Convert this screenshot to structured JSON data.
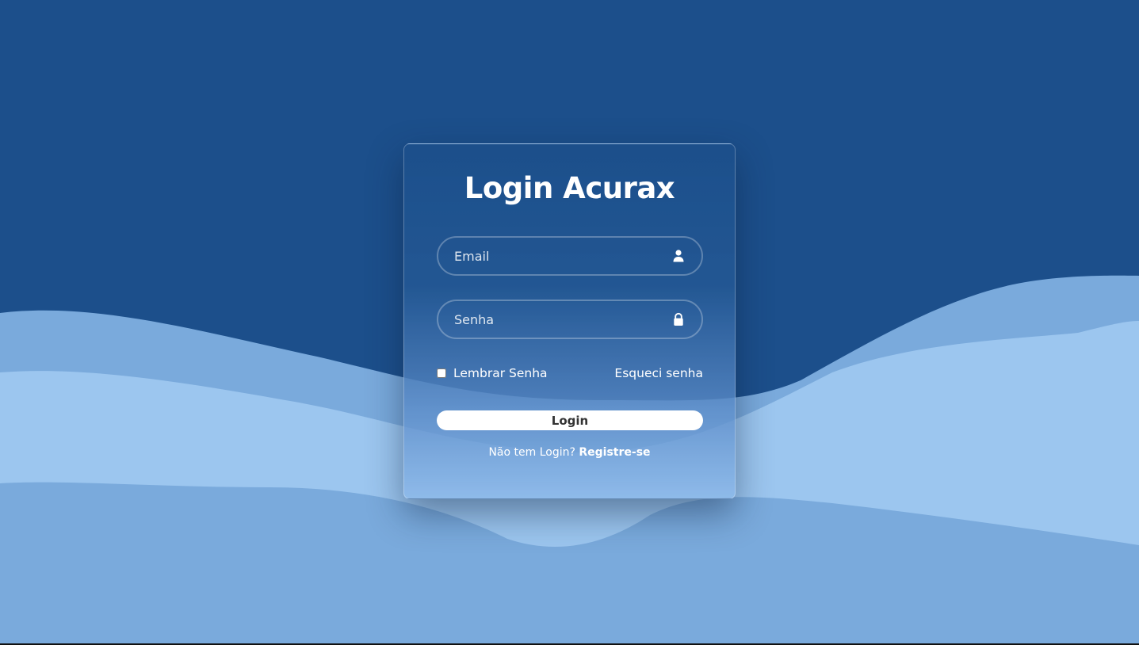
{
  "colors": {
    "background_dark": "#1c4f8b",
    "wave_mid": "#7aaadc",
    "wave_light": "#9cc6ef",
    "button_bg": "#ffffff",
    "button_text": "#333333",
    "text": "#ffffff"
  },
  "login": {
    "title": "Login Acurax",
    "email": {
      "placeholder": "Email",
      "value": "",
      "icon": "user-icon"
    },
    "password": {
      "placeholder": "Senha",
      "value": "",
      "icon": "lock-icon"
    },
    "remember_label": "Lembrar Senha",
    "remember_checked": false,
    "forgot_label": "Esqueci senha",
    "submit_label": "Login",
    "register_prompt": "Não tem Login?",
    "register_link": "Registre-se"
  }
}
